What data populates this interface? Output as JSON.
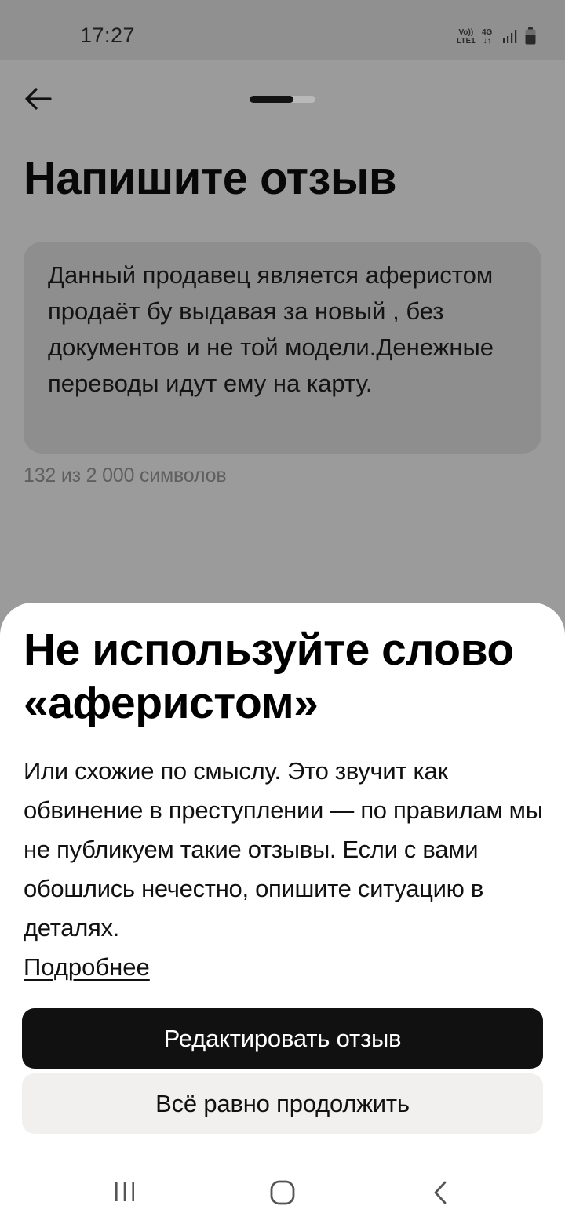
{
  "status_bar": {
    "time": "17:27",
    "network_line1": "Vo))",
    "network_line2": "LTE1",
    "data_type": "4G",
    "data_arrows": "↓↑",
    "signal_icon": "signal-bars-icon",
    "battery_icon": "battery-icon"
  },
  "header": {
    "back_icon": "arrow-left-icon",
    "progress_fraction": 0.67
  },
  "page": {
    "title": "Напишите отзыв",
    "review_text": "Данный продавец является аферистом продаёт бу выдавая за новый , без документов и не той модели.Денежные переводы идут ему на карту.",
    "char_counter": "132 из 2 000 символов"
  },
  "sheet": {
    "title": "Не используйте слово «аферистом»",
    "body": "Или схожие по смыслу. Это звучит как обвинение в преступлении — по правилам мы не публикуем такие отзывы. Если с вами обошлись нечестно, опишите ситуацию в деталях.",
    "more_link": "Подробнее",
    "primary_button": "Редактировать отзыв",
    "secondary_button": "Всё равно продолжить"
  },
  "nav_bar": {
    "recents_icon": "recents-icon",
    "home_icon": "home-icon",
    "back_icon": "back-chevron-icon"
  },
  "colors": {
    "overlay_background": "#9b9b9b",
    "sheet_background": "#ffffff",
    "primary_button": "#111111",
    "secondary_button": "#f1f0ef"
  }
}
